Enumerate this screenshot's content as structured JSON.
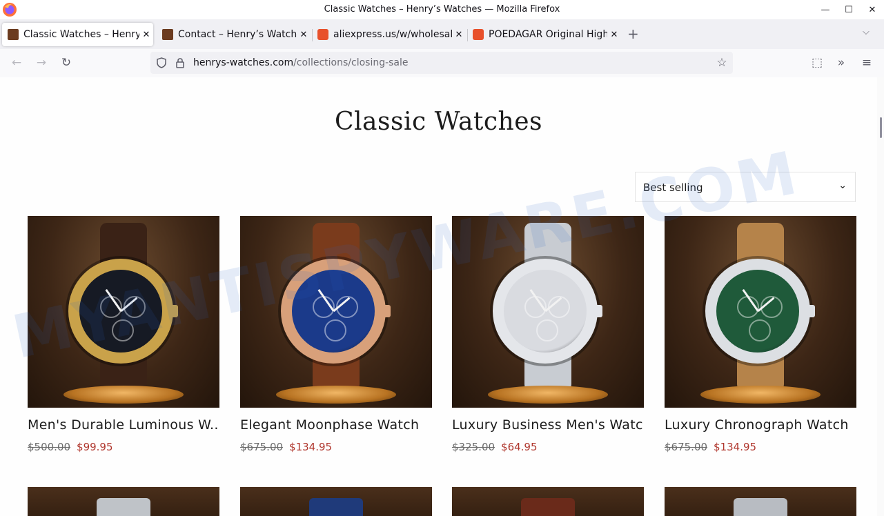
{
  "window": {
    "title": "Classic Watches – Henry’s Watches — Mozilla Firefox",
    "minimize_glyph": "—",
    "maximize_glyph": "☐",
    "close_glyph": "✕"
  },
  "tabs": [
    {
      "label": "Classic Watches – Henry’s Watches",
      "favicon": "henrys-watches-favicon",
      "active": true
    },
    {
      "label": "Contact – Henry’s Watches",
      "favicon": "henrys-watches-favicon",
      "active": false
    },
    {
      "label": "aliexpress.us/w/wholesale",
      "favicon": "aliexpress-favicon",
      "active": false
    },
    {
      "label": "POEDAGAR Original High",
      "favicon": "aliexpress-favicon",
      "active": false
    }
  ],
  "tab_close_glyph": "✕",
  "new_tab_glyph": "+",
  "tab_list_glyph": "⌵",
  "nav": {
    "back_glyph": "←",
    "forward_glyph": "→",
    "reload_glyph": "↻",
    "bookmark_glyph": "☆",
    "extensions_glyph": "⬚",
    "overflow_glyph": "»",
    "menu_glyph": "≡"
  },
  "urlbar": {
    "domain": "henrys-watches.com",
    "path": "/collections/closing-sale"
  },
  "page": {
    "collection_title": "Classic Watches",
    "sort": {
      "selected": "Best selling",
      "chevron": "⌄"
    }
  },
  "products": [
    {
      "name": "Men's Durable Luminous W...",
      "old_price": "$500.00",
      "price": "$99.95",
      "strap": "#3a2216",
      "dial": "#161a24",
      "case": "#c9a24a"
    },
    {
      "name": "Elegant Moonphase Watch",
      "old_price": "$675.00",
      "price": "$134.95",
      "strap": "#7a3b1c",
      "dial": "#1b3a8a",
      "case": "#d8a07a"
    },
    {
      "name": "Luxury Business Men's Watch",
      "old_price": "$325.00",
      "price": "$64.95",
      "strap": "#c8ccd2",
      "dial": "#d9dbe0",
      "case": "#e4e6ea"
    },
    {
      "name": "Luxury Chronograph Watch",
      "old_price": "$675.00",
      "price": "$134.95",
      "strap": "#b5834a",
      "dial": "#1f5a3a",
      "case": "#dcdfe3"
    }
  ],
  "second_row_bands": [
    "#bfc3c8",
    "#1f3a7a",
    "#6a2a1a",
    "#b8bcc2"
  ],
  "watermark": "MYANTISPYWARE.COM",
  "colors": {
    "sale_price": "#b0372e",
    "old_price": "#6b6b6b"
  }
}
